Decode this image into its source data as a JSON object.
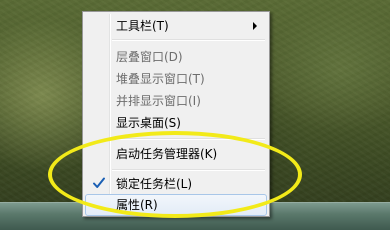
{
  "context_menu": {
    "items": [
      {
        "label": "工具栏(T)",
        "enabled": true,
        "submenu": true
      },
      {
        "label": "层叠窗口(D)",
        "enabled": false
      },
      {
        "label": "堆叠显示窗口(T)",
        "enabled": false
      },
      {
        "label": "并排显示窗口(I)",
        "enabled": false
      },
      {
        "label": "显示桌面(S)",
        "enabled": true
      },
      {
        "label": "启动任务管理器(K)",
        "enabled": true
      },
      {
        "label": "锁定任务栏(L)",
        "enabled": true,
        "checked": true
      },
      {
        "label": "属性(R)",
        "enabled": true,
        "hovered": true
      }
    ]
  },
  "annotation": {
    "color": "#f2ea19",
    "shape": "ellipse"
  },
  "colors": {
    "check_mark": "#1a5fb4",
    "disabled_text": "#6d6d6d",
    "hover_border": "#a8c6e8"
  }
}
